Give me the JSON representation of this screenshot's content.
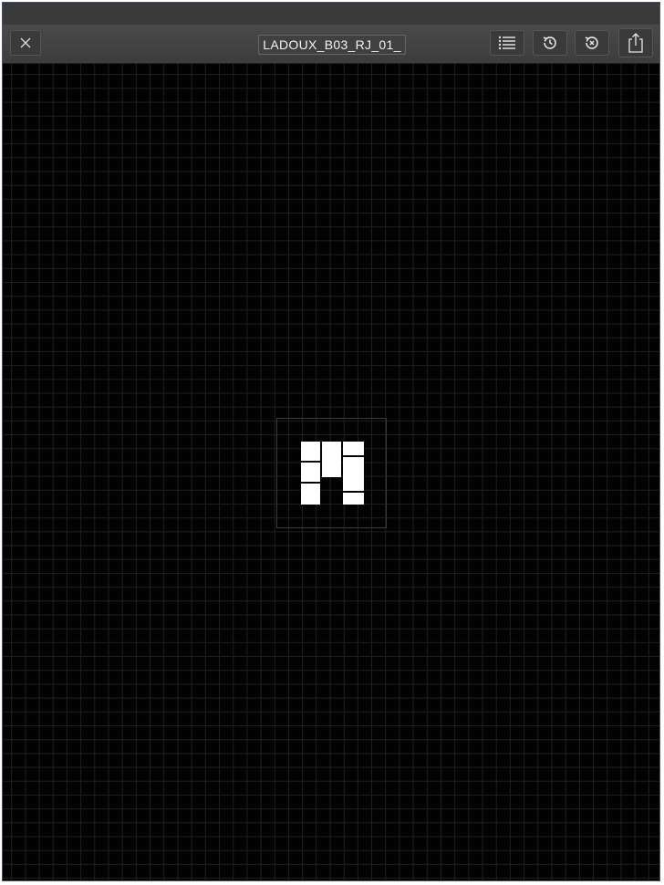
{
  "toolbar": {
    "title": "LADOUX_B03_RJ_01_",
    "close_icon": "close-icon",
    "list_icon": "list-icon",
    "history_icon": "history-icon",
    "clear_icon": "clear-icon",
    "share_icon": "share-icon"
  },
  "colors": {
    "canvas_background": "#020202",
    "grid_line": "#1f1f22",
    "toolbar_background": "#404040",
    "tile": "#ffffff"
  }
}
